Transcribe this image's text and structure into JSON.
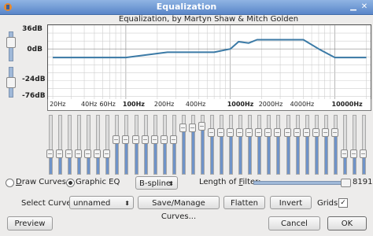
{
  "window": {
    "title": "Equalization",
    "accent": "#5a86c9"
  },
  "plot": {
    "title": "Equalization, by Martyn Shaw & Mitch Golden",
    "ylabels": [
      "36dB",
      "0dB",
      "-24dB",
      "-76dB"
    ],
    "xlabels": [
      {
        "text": "20Hz",
        "bold": false
      },
      {
        "text": "40Hz",
        "bold": false
      },
      {
        "text": "60Hz",
        "bold": false
      },
      {
        "text": "100Hz",
        "bold": true
      },
      {
        "text": "200Hz",
        "bold": false
      },
      {
        "text": "400Hz",
        "bold": false
      },
      {
        "text": "1000Hz",
        "bold": true
      },
      {
        "text": "2000Hz",
        "bold": false
      },
      {
        "text": "4000Hz",
        "bold": false
      },
      {
        "text": "10000Hz",
        "bold": true
      }
    ],
    "curve_color": "#3b7aa6"
  },
  "curve_gain_db": {
    "x_hz": [
      20,
      100,
      250,
      700,
      1000,
      1200,
      1500,
      1800,
      2500,
      5000,
      7000,
      10000,
      20000
    ],
    "y_db": [
      -13,
      -13,
      -5,
      -5,
      0,
      11,
      9,
      14,
      14,
      14,
      0,
      -13,
      -13
    ]
  },
  "eq_sliders": [
    0.35,
    0.35,
    0.35,
    0.35,
    0.35,
    0.35,
    0.35,
    0.6,
    0.6,
    0.6,
    0.6,
    0.6,
    0.6,
    0.6,
    0.8,
    0.8,
    0.82,
    0.72,
    0.72,
    0.72,
    0.72,
    0.72,
    0.72,
    0.72,
    0.72,
    0.72,
    0.72,
    0.72,
    0.72,
    0.72,
    0.72,
    0.35,
    0.35,
    0.35
  ],
  "controls": {
    "draw_curves": "Draw Curves",
    "graphic_eq": "Graphic EQ",
    "interp": "B-spline",
    "length_label_pre": "Length of ",
    "length_label_u": "F",
    "length_label_post": "ilter:",
    "length_value": "8191",
    "select_curve_label": "Select Curve:",
    "curve_name": "unnamed",
    "save_manage": "Save/Manage Curves...",
    "flatten": "Flatten",
    "invert": "Invert",
    "grids": "Grids",
    "preview": "Preview",
    "cancel": "Cancel",
    "ok": "OK"
  }
}
